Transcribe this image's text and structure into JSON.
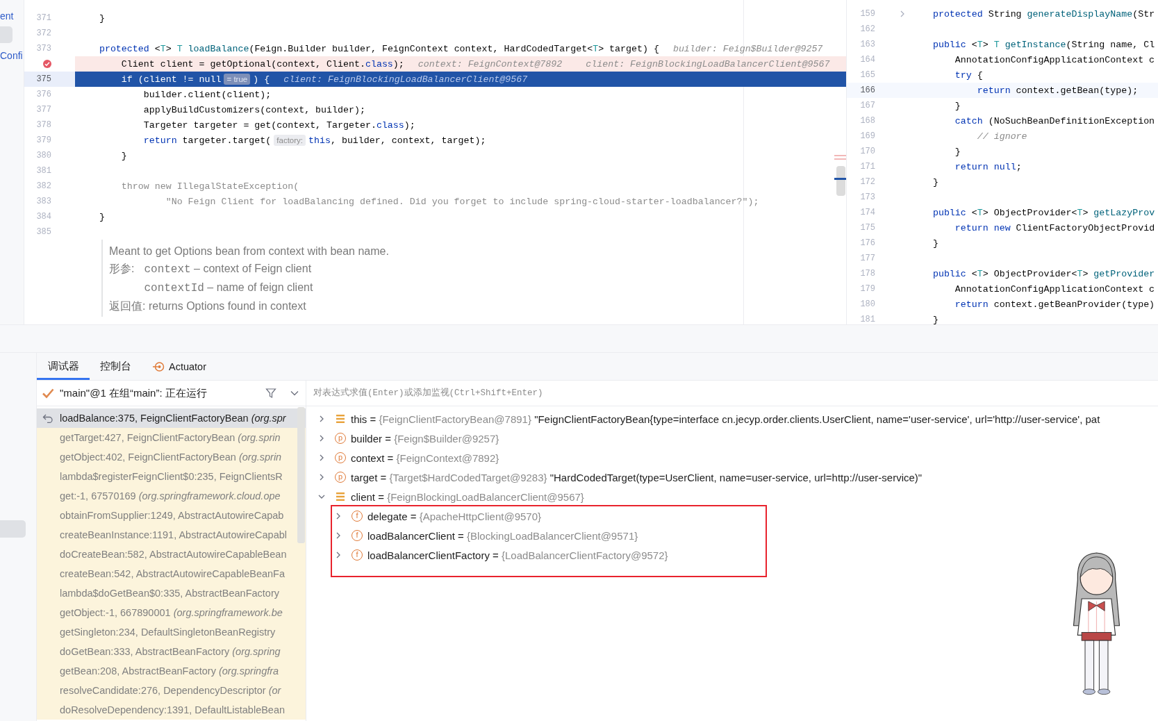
{
  "project_panel": {
    "items": [
      {
        "kind": "text",
        "text": "ent"
      },
      {
        "kind": "tile"
      },
      {
        "kind": "text",
        "text": "Confi"
      }
    ]
  },
  "editor": {
    "lines": [
      {
        "number": "371",
        "kind": "normal",
        "segments": [
          {
            "kind": "plain",
            "text": "    }"
          }
        ]
      },
      {
        "number": "372",
        "kind": "normal"
      },
      {
        "number": "373",
        "kind": "normal",
        "segments": [
          {
            "kind": "keyword",
            "text": "    protected"
          },
          {
            "kind": "plain",
            "text": " <"
          },
          {
            "kind": "type_param",
            "text": "T"
          },
          {
            "kind": "plain",
            "text": "> "
          },
          {
            "kind": "type_param",
            "text": "T"
          },
          {
            "kind": "declaration",
            "text": " loadBalance"
          },
          {
            "kind": "plain",
            "text": "(Feign.Builder builder, FeignContext context, HardCodedTarget<"
          },
          {
            "kind": "type_param",
            "text": "T"
          },
          {
            "kind": "plain",
            "text": "> target) {"
          },
          {
            "kind": "hint",
            "text": "builder: Feign$Builder@9257"
          }
        ]
      },
      {
        "kind": "breakpoint",
        "segments": [
          {
            "kind": "plain",
            "text": "        Client client = getOptional(context, Client."
          },
          {
            "kind": "keyword",
            "text": "class"
          },
          {
            "kind": "plain",
            "text": ");"
          },
          {
            "kind": "hint",
            "text": "context: FeignContext@7892"
          },
          {
            "kind": "hint",
            "text": "client: FeignBlockingLoadBalancerClient@9567"
          }
        ]
      },
      {
        "number": "375",
        "kind": "execution",
        "segments": [
          {
            "kind": "keyword",
            "text": "        if"
          },
          {
            "kind": "plain",
            "text": " (client != null"
          },
          {
            "kind": "inlay",
            "text": "= true"
          },
          {
            "kind": "plain",
            "text": ") {"
          },
          {
            "kind": "hint",
            "text": "client: FeignBlockingLoadBalancerClient@9567"
          }
        ]
      },
      {
        "number": "376",
        "kind": "normal",
        "segments": [
          {
            "kind": "plain",
            "text": "            builder.client(client);"
          }
        ]
      },
      {
        "number": "377",
        "kind": "normal",
        "segments": [
          {
            "kind": "plain",
            "text": "            applyBuildCustomizers(context, builder);"
          }
        ]
      },
      {
        "number": "378",
        "kind": "normal",
        "segments": [
          {
            "kind": "plain",
            "text": "            Targeter targeter = get(context, Targeter."
          },
          {
            "kind": "keyword",
            "text": "class"
          },
          {
            "kind": "plain",
            "text": ");"
          }
        ]
      },
      {
        "number": "379",
        "kind": "normal",
        "segments": [
          {
            "kind": "keyword",
            "text": "            return"
          },
          {
            "kind": "plain",
            "text": " targeter.target("
          },
          {
            "kind": "inlay",
            "text": "factory:"
          },
          {
            "kind": "keyword",
            "text": "this"
          },
          {
            "kind": "plain",
            "text": ", builder, context, target);"
          }
        ]
      },
      {
        "number": "380",
        "kind": "normal",
        "segments": [
          {
            "kind": "plain",
            "text": "        }"
          }
        ]
      },
      {
        "number": "381",
        "kind": "normal"
      },
      {
        "number": "382",
        "kind": "normal",
        "segments": [
          {
            "kind": "dim",
            "text": "        throw new IllegalStateException("
          }
        ]
      },
      {
        "number": "383",
        "kind": "normal",
        "segments": [
          {
            "kind": "dim",
            "text": "                \"No Feign Client for loadBalancing defined. Did you forget to include spring-cloud-starter-loadbalancer?\");"
          }
        ]
      },
      {
        "number": "384",
        "kind": "normal",
        "segments": [
          {
            "kind": "plain",
            "text": "    }"
          }
        ]
      },
      {
        "number": "385",
        "kind": "normal"
      }
    ],
    "doc": {
      "summary": "Meant to get Options bean from context with bean name.",
      "params_label": "形参:",
      "params": [
        {
          "name": "context",
          "description": "– context of Feign client"
        },
        {
          "name": "contextId",
          "description": "– name of feign client"
        }
      ],
      "return_label": "返回值:",
      "return_text": "returns Options found in context"
    }
  },
  "side_editor": {
    "lines": [
      {
        "number": "159",
        "kind": "normal",
        "folded": true,
        "segments": [
          {
            "kind": "keyword",
            "text": "    protected"
          },
          {
            "kind": "plain",
            "text": " String "
          },
          {
            "kind": "declaration",
            "text": "generateDisplayName"
          },
          {
            "kind": "plain",
            "text": "(Str"
          }
        ]
      },
      {
        "number": "162",
        "kind": "normal"
      },
      {
        "number": "163",
        "kind": "normal",
        "segments": [
          {
            "kind": "keyword",
            "text": "    public"
          },
          {
            "kind": "plain",
            "text": " <"
          },
          {
            "kind": "type_param",
            "text": "T"
          },
          {
            "kind": "plain",
            "text": "> "
          },
          {
            "kind": "type_param",
            "text": "T"
          },
          {
            "kind": "declaration",
            "text": " getInstance"
          },
          {
            "kind": "plain",
            "text": "(String name, Cl"
          }
        ]
      },
      {
        "number": "164",
        "kind": "normal",
        "segments": [
          {
            "kind": "plain",
            "text": "        AnnotationConfigApplicationContext c"
          }
        ]
      },
      {
        "number": "165",
        "kind": "normal",
        "segments": [
          {
            "kind": "keyword",
            "text": "        try"
          },
          {
            "kind": "plain",
            "text": " {"
          }
        ]
      },
      {
        "number": "166",
        "kind": "caret",
        "segments": [
          {
            "kind": "keyword",
            "text": "            return"
          },
          {
            "kind": "plain",
            "text": " context.getBean(type);"
          }
        ]
      },
      {
        "number": "167",
        "kind": "normal",
        "segments": [
          {
            "kind": "plain",
            "text": "        }"
          }
        ]
      },
      {
        "number": "168",
        "kind": "normal",
        "segments": [
          {
            "kind": "keyword",
            "text": "        catch"
          },
          {
            "kind": "plain",
            "text": " (NoSuchBeanDefinitionException"
          }
        ]
      },
      {
        "number": "169",
        "kind": "normal",
        "segments": [
          {
            "kind": "comment",
            "text": "            // ignore"
          }
        ]
      },
      {
        "number": "170",
        "kind": "normal",
        "segments": [
          {
            "kind": "plain",
            "text": "        }"
          }
        ]
      },
      {
        "number": "171",
        "kind": "normal",
        "segments": [
          {
            "kind": "keyword",
            "text": "        return"
          },
          {
            "kind": "keyword",
            "text": " null"
          },
          {
            "kind": "plain",
            "text": ";"
          }
        ]
      },
      {
        "number": "172",
        "kind": "normal",
        "segments": [
          {
            "kind": "plain",
            "text": "    }"
          }
        ]
      },
      {
        "number": "173",
        "kind": "normal"
      },
      {
        "number": "174",
        "kind": "normal",
        "segments": [
          {
            "kind": "keyword",
            "text": "    public"
          },
          {
            "kind": "plain",
            "text": " <"
          },
          {
            "kind": "type_param",
            "text": "T"
          },
          {
            "kind": "plain",
            "text": "> ObjectProvider<"
          },
          {
            "kind": "type_param",
            "text": "T"
          },
          {
            "kind": "plain",
            "text": "> "
          },
          {
            "kind": "declaration",
            "text": "getLazyProv"
          }
        ]
      },
      {
        "number": "175",
        "kind": "normal",
        "segments": [
          {
            "kind": "keyword",
            "text": "        return"
          },
          {
            "kind": "keyword",
            "text": " new"
          },
          {
            "kind": "plain",
            "text": " ClientFactoryObjectProvid"
          }
        ]
      },
      {
        "number": "176",
        "kind": "normal",
        "segments": [
          {
            "kind": "plain",
            "text": "    }"
          }
        ]
      },
      {
        "number": "177",
        "kind": "normal"
      },
      {
        "number": "178",
        "kind": "normal",
        "segments": [
          {
            "kind": "keyword",
            "text": "    public"
          },
          {
            "kind": "plain",
            "text": " <"
          },
          {
            "kind": "type_param",
            "text": "T"
          },
          {
            "kind": "plain",
            "text": "> ObjectProvider<"
          },
          {
            "kind": "type_param",
            "text": "T"
          },
          {
            "kind": "plain",
            "text": "> "
          },
          {
            "kind": "declaration",
            "text": "getProvider"
          }
        ]
      },
      {
        "number": "179",
        "kind": "normal",
        "segments": [
          {
            "kind": "plain",
            "text": "        AnnotationConfigApplicationContext c"
          }
        ]
      },
      {
        "number": "180",
        "kind": "normal",
        "segments": [
          {
            "kind": "keyword",
            "text": "        return"
          },
          {
            "kind": "plain",
            "text": " context.getBeanProvider(type)"
          }
        ]
      },
      {
        "number": "181",
        "kind": "normal",
        "segments": [
          {
            "kind": "plain",
            "text": "    }"
          }
        ]
      }
    ]
  },
  "tabs": [
    {
      "kind": "text",
      "label": "调试器",
      "selected": true
    },
    {
      "kind": "text",
      "label": "控制台",
      "selected": false
    },
    {
      "kind": "actuator",
      "label": "Actuator",
      "selected": false
    }
  ],
  "thread": {
    "text": "\"main\"@1 在组“main”: 正在运行"
  },
  "frames": [
    {
      "text": "loadBalance:375, FeignClientFactoryBean *(org.spr*",
      "selected": true
    },
    {
      "text": "getTarget:427, FeignClientFactoryBean *(org.sprin*",
      "selected": false
    },
    {
      "text": "getObject:402, FeignClientFactoryBean *(org.sprin*",
      "selected": false
    },
    {
      "text": "lambda$registerFeignClient$0:235, FeignClientsR",
      "selected": false
    },
    {
      "text": "get:-1, 67570169 *(org.springframework.cloud.ope*",
      "selected": false
    },
    {
      "text": "obtainFromSupplier:1249, AbstractAutowireCapab",
      "selected": false
    },
    {
      "text": "createBeanInstance:1191, AbstractAutowireCapabl",
      "selected": false
    },
    {
      "text": "doCreateBean:582, AbstractAutowireCapableBean",
      "selected": false
    },
    {
      "text": "createBean:542, AbstractAutowireCapableBeanFa",
      "selected": false
    },
    {
      "text": "lambda$doGetBean$0:335, AbstractBeanFactory",
      "selected": false
    },
    {
      "text": "getObject:-1, 667890001 *(org.springframework.be*",
      "selected": false
    },
    {
      "text": "getSingleton:234, DefaultSingletonBeanRegistry",
      "selected": false
    },
    {
      "text": "doGetBean:333, AbstractBeanFactory *(org.spring*",
      "selected": false
    },
    {
      "text": "getBean:208, AbstractBeanFactory *(org.springfra*",
      "selected": false
    },
    {
      "text": "resolveCandidate:276, DependencyDescriptor *(or*",
      "selected": false
    },
    {
      "text": "doResolveDependency:1391, DefaultListableBean",
      "selected": false
    }
  ],
  "evaluate": {
    "placeholder": "对表达式求值(Enter)或添加监视(Ctrl+Shift+Enter)"
  },
  "variables": [
    {
      "kind": "object",
      "name": "this",
      "sign": "=",
      "value": "{FeignClientFactoryBean@7891}",
      "text": "\"FeignClientFactoryBean{type=interface cn.jecyp.order.clients.UserClient, name='user-service', url='http://user-service', pat",
      "expanded": false
    },
    {
      "kind": "param",
      "badge": "p",
      "name": "builder",
      "sign": "=",
      "value": "{Feign$Builder@9257}",
      "expanded": false
    },
    {
      "kind": "param",
      "badge": "p",
      "name": "context",
      "sign": "=",
      "value": "{FeignContext@7892}",
      "expanded": false
    },
    {
      "kind": "param",
      "badge": "p",
      "name": "target",
      "sign": "=",
      "value": "{Target$HardCodedTarget@9283}",
      "text": "\"HardCodedTarget(type=UserClient, name=user-service, url=http://user-service)\"",
      "expanded": false
    },
    {
      "kind": "object",
      "name": "client",
      "sign": "=",
      "value": "{FeignBlockingLoadBalancerClient@9567}",
      "expanded": true,
      "highlighted": true,
      "children": [
        {
          "kind": "field",
          "badge": "f",
          "name": "delegate",
          "sign": "=",
          "value": "{ApacheHttpClient@9570}",
          "expanded": false
        },
        {
          "kind": "field",
          "badge": "f",
          "name": "loadBalancerClient",
          "sign": "=",
          "value": "{BlockingLoadBalancerClient@9571}",
          "expanded": false
        },
        {
          "kind": "field",
          "badge": "f",
          "name": "loadBalancerClientFactory",
          "sign": "=",
          "value": "{LoadBalancerClientFactory@9572}",
          "expanded": false
        }
      ]
    }
  ],
  "mascot": {
    "kind": "figure"
  }
}
